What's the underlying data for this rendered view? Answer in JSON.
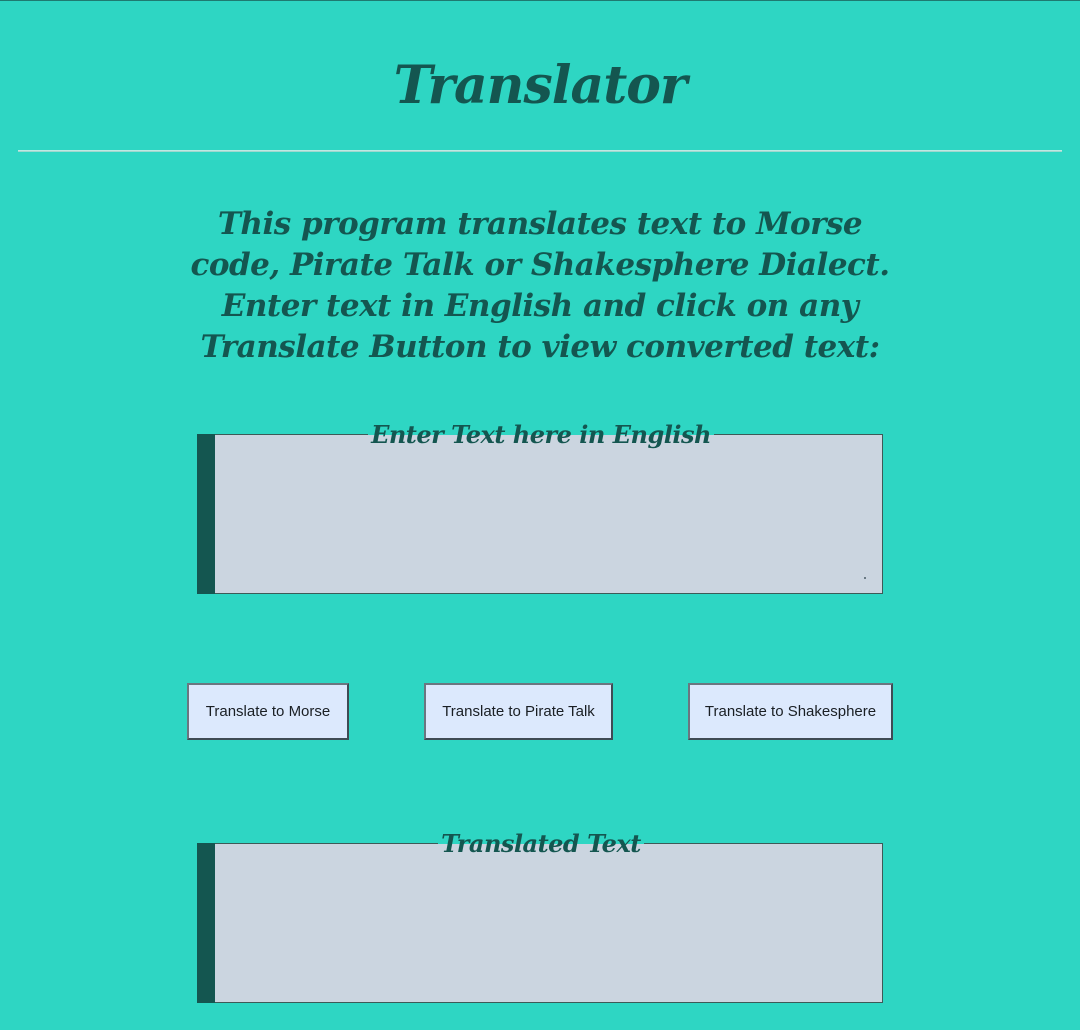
{
  "header": {
    "title": "Translator"
  },
  "intro": {
    "text": "This program translates text to Morse code, Pirate Talk or Shakesphere Dialect. Enter text in English and click on any Translate Button to view converted text:"
  },
  "input": {
    "legend": "Enter Text here in English",
    "value": ""
  },
  "buttons": {
    "morse": "Translate to Morse",
    "pirate": "Translate to Pirate Talk",
    "shakespeare": "Translate to Shakesphere"
  },
  "output": {
    "legend": "Translated Text",
    "value": ""
  },
  "colors": {
    "background": "#2ed6c3",
    "heading": "#145650",
    "field": "#cbd5e0",
    "button": "#dce9fd"
  }
}
